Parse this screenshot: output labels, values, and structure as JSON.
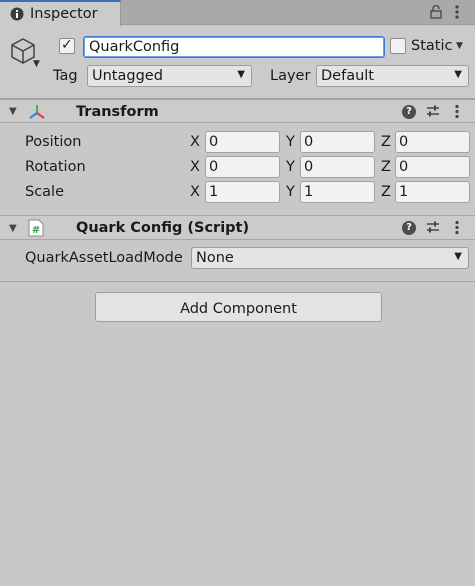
{
  "window": {
    "tab_label": "Inspector",
    "tab_icon": "info-icon",
    "lock_icon": "lock-icon",
    "menu_icon": "kebab-menu-icon"
  },
  "gameobject": {
    "icon": "cube-icon",
    "active": true,
    "name": "QuarkConfig",
    "static_label": "Static",
    "static_checked": false,
    "tag_label": "Tag",
    "tag_value": "Untagged",
    "layer_label": "Layer",
    "layer_value": "Default"
  },
  "transform": {
    "title": "Transform",
    "rows": [
      {
        "label": "Position",
        "x": "0",
        "y": "0",
        "z": "0"
      },
      {
        "label": "Rotation",
        "x": "0",
        "y": "0",
        "z": "0"
      },
      {
        "label": "Scale",
        "x": "1",
        "y": "1",
        "z": "1"
      }
    ],
    "axis_labels": [
      "X",
      "Y",
      "Z"
    ]
  },
  "script_component": {
    "title": "Quark Config (Script)",
    "icon": "csharp-script-icon",
    "field_label": "QuarkAssetLoadMode",
    "field_value": "None"
  },
  "add_component_label": "Add Component",
  "colors": {
    "panel_bg": "#c8c8c8",
    "accent_blue": "#3d7ad6"
  }
}
